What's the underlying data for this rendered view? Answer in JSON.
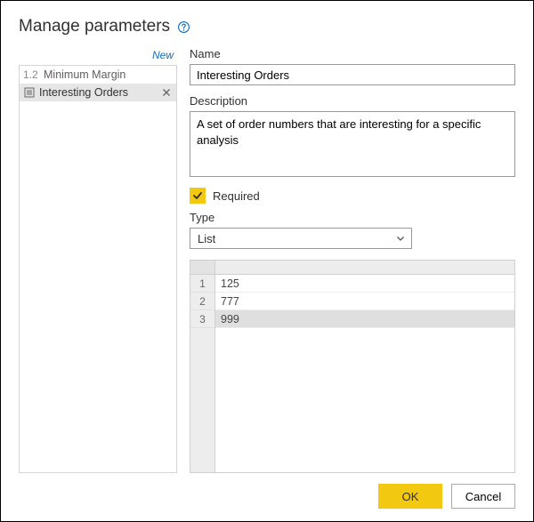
{
  "dialog": {
    "title": "Manage parameters",
    "new_link": "New"
  },
  "sidebar": {
    "items": [
      {
        "prefix": "1.2",
        "label": "Minimum Margin",
        "icon": "number",
        "selected": false
      },
      {
        "prefix": "",
        "label": "Interesting Orders",
        "icon": "list",
        "selected": true
      }
    ]
  },
  "form": {
    "name_label": "Name",
    "name_value": "Interesting Orders",
    "desc_label": "Description",
    "desc_value": "A set of order numbers that are interesting for a specific analysis",
    "required_label": "Required",
    "required_checked": true,
    "type_label": "Type",
    "type_value": "List"
  },
  "grid": {
    "rows": [
      {
        "n": "1",
        "v": "125"
      },
      {
        "n": "2",
        "v": "777"
      },
      {
        "n": "3",
        "v": "999"
      }
    ]
  },
  "footer": {
    "ok": "OK",
    "cancel": "Cancel"
  }
}
